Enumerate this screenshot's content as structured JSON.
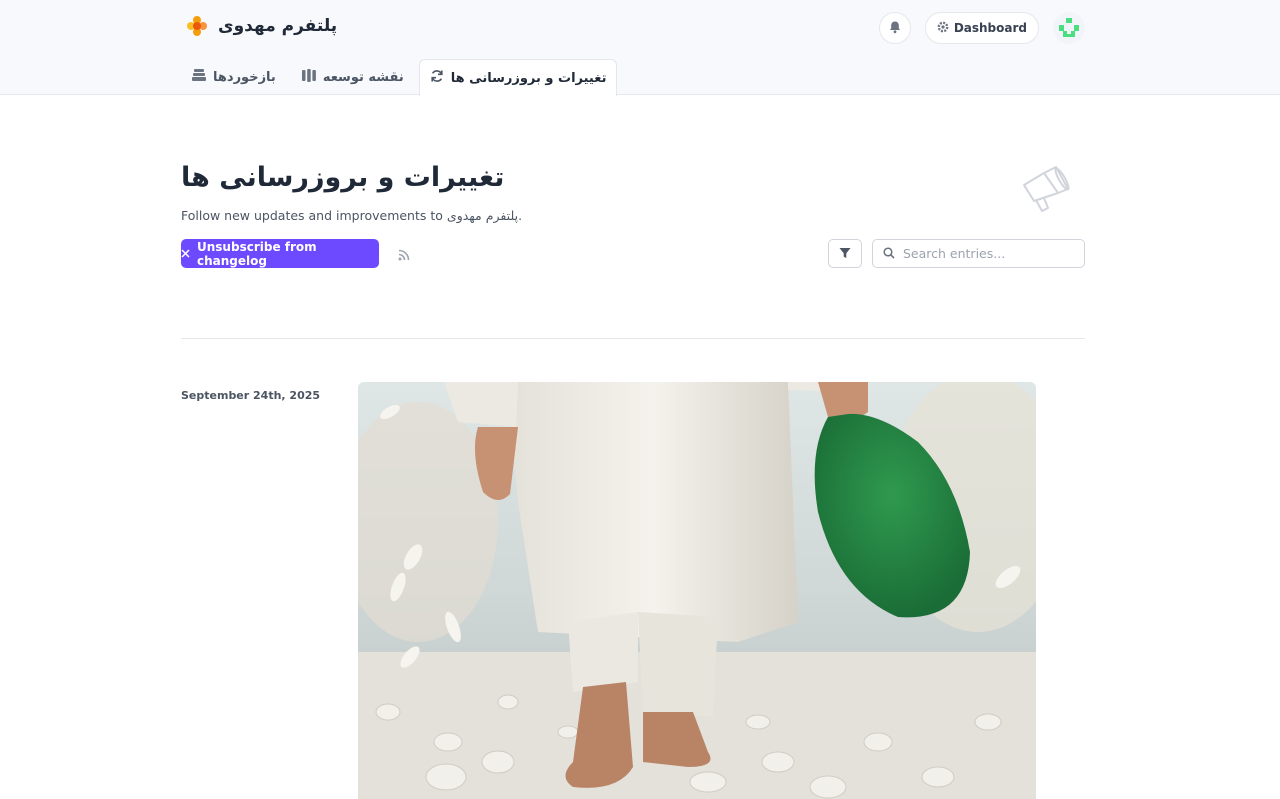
{
  "header": {
    "brand_name": "پلتفرم مهدوی",
    "dashboard_label": "Dashboard"
  },
  "tabs": [
    {
      "label": "تغییرات و بروزرسانی ها",
      "icon": "refresh-icon",
      "active": true
    },
    {
      "label": "نقشه توسعه",
      "icon": "roadmap-icon",
      "active": false
    },
    {
      "label": "بازخوردها",
      "icon": "feedback-icon",
      "active": false
    }
  ],
  "main": {
    "title": "تغییرات و بروزرسانی ها",
    "subtitle": "Follow new updates and improvements to پلتفرم مهدوی.",
    "unsubscribe_label": "Unsubscribe from changelog",
    "search_placeholder": "Search entries..."
  },
  "entries": [
    {
      "date": "September 24th, 2025"
    }
  ],
  "colors": {
    "accent": "#6d4aff",
    "header_bg": "#f8f9fc"
  }
}
